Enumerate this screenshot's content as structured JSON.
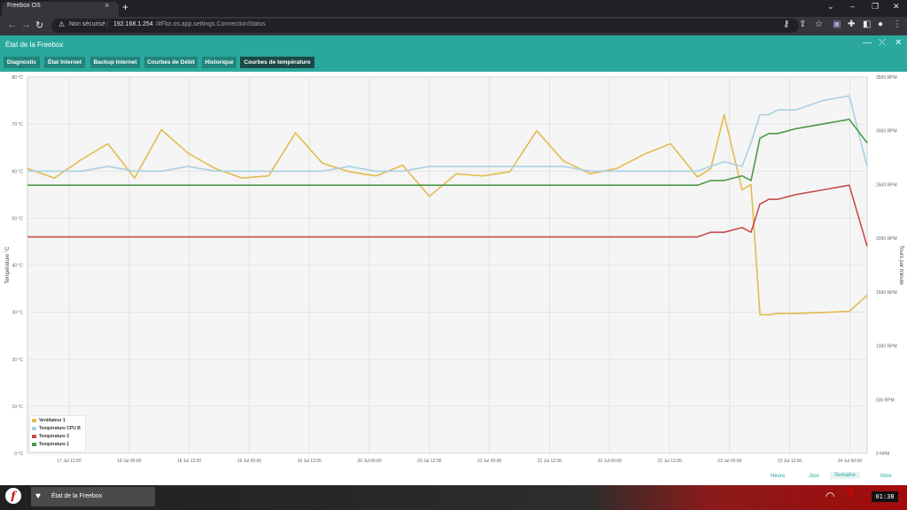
{
  "browser": {
    "tab_title": "Freebox OS",
    "new_tab_icon": "plus-icon",
    "security_label": "Non sécurisé",
    "url_host": "192.168.1.254",
    "url_path": "/#Fbx.os.app.settings.ConnectionStatus"
  },
  "app": {
    "title": "État de la Freebox",
    "tabs": [
      "Diagnostic",
      "État Internet",
      "Backup Internet",
      "Courbes de Débit",
      "Historique",
      "Courbes de température"
    ],
    "active_tab": "Courbes de température",
    "periods": [
      "Heure",
      "Jour",
      "Semaine",
      "Mois"
    ],
    "active_period": "Semaine"
  },
  "taskbar": {
    "item_label": "État de la Freebox",
    "clock": "01:38"
  },
  "chart_data": {
    "type": "line",
    "ylabel": "Température °C",
    "ylabel_right": "Tours par minute",
    "ylim": [
      0,
      80
    ],
    "y_ticks": [
      "0 °C",
      "10 °C",
      "20 °C",
      "30 °C",
      "40 °C",
      "50 °C",
      "60 °C",
      "70 °C",
      "80 °C"
    ],
    "ylim_right": [
      0,
      3500
    ],
    "y_ticks_right": [
      "0 RPM",
      "500 RPM",
      "1000 RPM",
      "1500 RPM",
      "2000 RPM",
      "2500 RPM",
      "3000 RPM",
      "3500 RPM"
    ],
    "x_labels": [
      "17 Jul 12:00",
      "18 Jul 00:00",
      "18 Jul 12:00",
      "19 Jul 00:00",
      "19 Jul 12:00",
      "20 Jul 00:00",
      "20 Jul 12:00",
      "21 Jul 00:00",
      "21 Jul 12:00",
      "22 Jul 00:00",
      "22 Jul 12:00",
      "23 Jul 00:00",
      "23 Jul 12:00",
      "24 Jul 00:00"
    ],
    "x": [
      0,
      6,
      12,
      18,
      24,
      30,
      36,
      42,
      48,
      54,
      60,
      66,
      72,
      78,
      84,
      90,
      96,
      102,
      108,
      114,
      120,
      126,
      132,
      138,
      144,
      150,
      153,
      156,
      160,
      162,
      164,
      166,
      168,
      172,
      178,
      184,
      188
    ],
    "series": [
      {
        "name": "Ventilateur 1",
        "axis": "right",
        "color": "#e3bb4f",
        "values": [
          2650,
          2560,
          2730,
          2880,
          2560,
          3010,
          2790,
          2650,
          2560,
          2580,
          2980,
          2700,
          2620,
          2580,
          2680,
          2390,
          2600,
          2580,
          2620,
          3000,
          2720,
          2600,
          2650,
          2780,
          2880,
          2570,
          2650,
          3150,
          2450,
          2500,
          1290,
          1290,
          1300,
          1300,
          1310,
          1320,
          1470
        ]
      },
      {
        "name": "Température CPU B",
        "axis": "left",
        "color": "#a9d0e3",
        "values": [
          60,
          60,
          60,
          61,
          60,
          60,
          61,
          60,
          60,
          60,
          60,
          60,
          61,
          60,
          60,
          61,
          61,
          61,
          61,
          61,
          61,
          60,
          60,
          60,
          60,
          60,
          61,
          62,
          61,
          66,
          72,
          72,
          73,
          73,
          75,
          76,
          61
        ]
      },
      {
        "name": "Température 2",
        "axis": "left",
        "color": "#c94b4b",
        "values": [
          46,
          46,
          46,
          46,
          46,
          46,
          46,
          46,
          46,
          46,
          46,
          46,
          46,
          46,
          46,
          46,
          46,
          46,
          46,
          46,
          46,
          46,
          46,
          46,
          46,
          46,
          47,
          47,
          48,
          47,
          53,
          54,
          54,
          55,
          56,
          57,
          44
        ]
      },
      {
        "name": "Température 1",
        "axis": "left",
        "color": "#4a9a4a",
        "values": [
          57,
          57,
          57,
          57,
          57,
          57,
          57,
          57,
          57,
          57,
          57,
          57,
          57,
          57,
          57,
          57,
          57,
          57,
          57,
          57,
          57,
          57,
          57,
          57,
          57,
          57,
          58,
          58,
          59,
          58,
          67,
          68,
          68,
          69,
          70,
          71,
          66
        ]
      }
    ],
    "grid": true,
    "legend": "bottom-left"
  }
}
